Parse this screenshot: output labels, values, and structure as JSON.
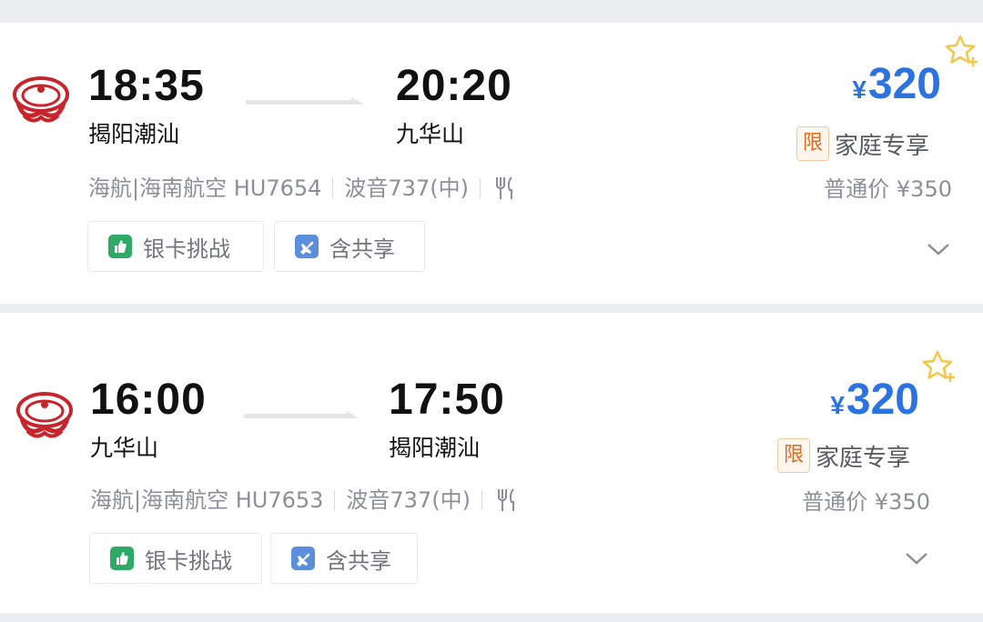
{
  "colors": {
    "price": "#2a73e0",
    "promo_badge": "#e06a1e",
    "silver_card_icon": "#2faa66",
    "share_icon": "#5b8fdc",
    "star": "#f2c84b",
    "airline_logo": "#c8242b"
  },
  "flights": [
    {
      "airline_logo_icon": "hainan-airlines-logo",
      "departure_time": "18:35",
      "departure_city": "揭阳潮汕",
      "arrival_time": "20:20",
      "arrival_city": "九华山",
      "airline": "海航|海南航空 HU7654",
      "aircraft": "波音737(中)",
      "meal_icon": "utensils-icon",
      "tags": [
        {
          "icon": "thumbs-up-icon",
          "label": "银卡挑战"
        },
        {
          "icon": "plane-icon",
          "label": "含共享"
        }
      ],
      "price_currency": "¥",
      "price": "320",
      "promo_badge": "限",
      "promo_label": "家庭专享",
      "normal_price": "普通价 ¥350"
    },
    {
      "airline_logo_icon": "hainan-airlines-logo",
      "departure_time": "16:00",
      "departure_city": "九华山",
      "arrival_time": "17:50",
      "arrival_city": "揭阳潮汕",
      "airline": "海航|海南航空 HU7653",
      "aircraft": "波音737(中)",
      "meal_icon": "utensils-icon",
      "tags": [
        {
          "icon": "thumbs-up-icon",
          "label": "银卡挑战"
        },
        {
          "icon": "plane-icon",
          "label": "含共享"
        }
      ],
      "price_currency": "¥",
      "price": "320",
      "promo_badge": "限",
      "promo_label": "家庭专享",
      "normal_price": "普通价 ¥350"
    }
  ]
}
